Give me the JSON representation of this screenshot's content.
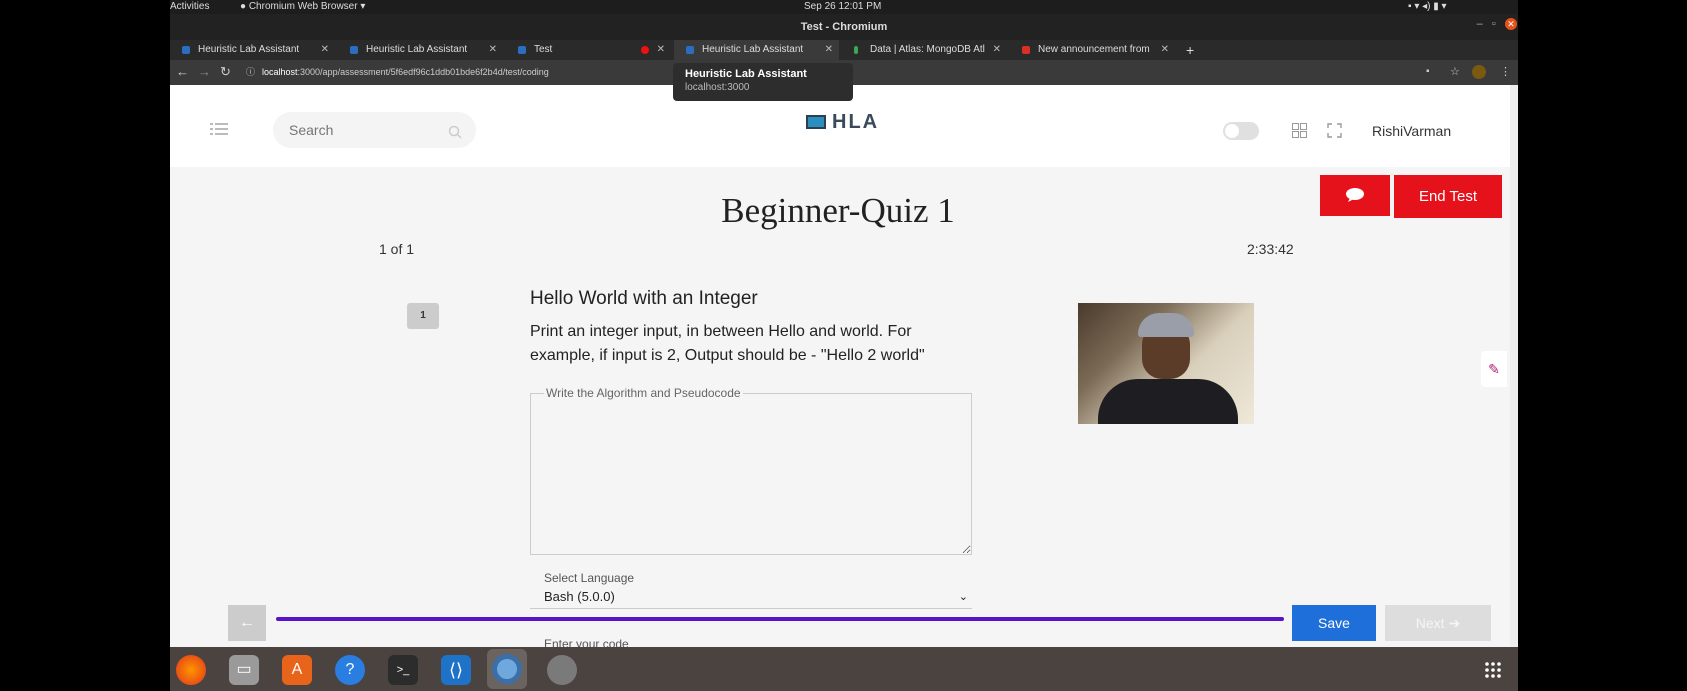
{
  "system": {
    "activities": "Activities",
    "browser_menu": "Chromium Web Browser",
    "clock": "Sep 26  12:01 PM"
  },
  "window": {
    "title": "Test - Chromium"
  },
  "tabs": [
    {
      "label": "Heuristic Lab Assistant"
    },
    {
      "label": "Heuristic Lab Assistant"
    },
    {
      "label": "Test"
    },
    {
      "label": "Heuristic Lab Assistant"
    },
    {
      "label": "Data | Atlas: MongoDB Atl"
    },
    {
      "label": "New announcement from"
    }
  ],
  "address": {
    "url_host": "localhost",
    "url_rest": ":3000/app/assessment/5f6edf96c1ddb01bde6f2b4d/test/coding"
  },
  "tooltip": {
    "title": "Heuristic Lab Assistant",
    "url": "localhost:3000"
  },
  "header": {
    "search_placeholder": "Search",
    "logo": "HLA",
    "user": "RishiVarman"
  },
  "actions": {
    "end_test": "End Test"
  },
  "quiz": {
    "title": "Beginner-Quiz 1",
    "counter": "1 of 1",
    "timer": "2:33:42",
    "question_number": "1",
    "question_title": "Hello World with an Integer",
    "question_desc": "Print an integer input, in between Hello and world. For example, if input is 2, Output should be - \"Hello 2 world\"",
    "algo_label": "Write the Algorithm and Pseudocode",
    "language_label": "Select Language",
    "language_selected": "Bash (5.0.0)",
    "code_label": "Enter your code"
  },
  "footer": {
    "save": "Save",
    "next": "Next",
    "progress": 1.0
  },
  "colors": {
    "accent_red": "#e5121c",
    "progress_purple": "#5a14c8",
    "save_blue": "#1e6fd9"
  }
}
